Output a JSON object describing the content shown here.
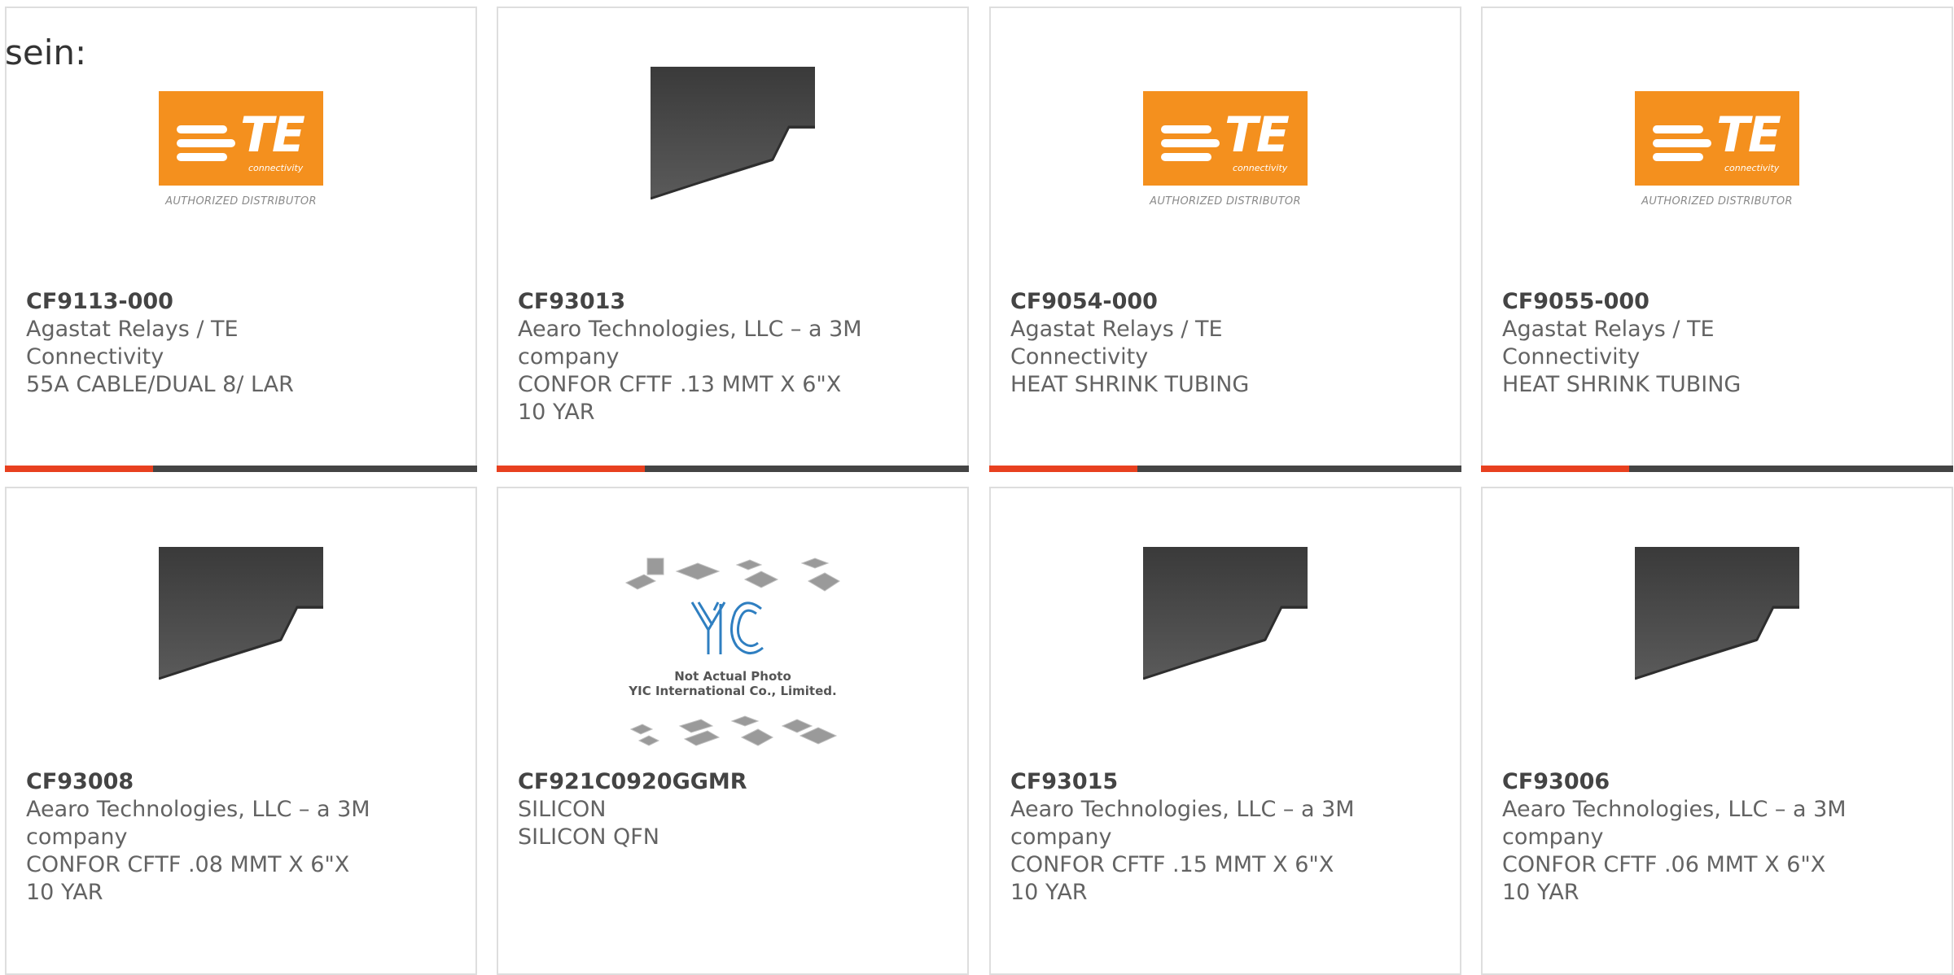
{
  "lead_text": "sein:",
  "logo": {
    "te_letters": "TE",
    "te_sub": "connectivity",
    "authorized": "AUTHORIZED DISTRIBUTOR"
  },
  "yic_image": {
    "mark": "YIC",
    "caption_line1": "Not Actual Photo",
    "caption_line2": "YIC International Co., Limited."
  },
  "colors": {
    "accent": "#e8401f",
    "bar": "#444444",
    "te_orange": "#f4901e",
    "yic_blue": "#2f7fc1"
  },
  "products": [
    {
      "part": "CF9113-000",
      "maker": "Agastat Relays / TE Connectivity",
      "desc": "55A CABLE/DUAL 8/ LAR",
      "image": "te-logo"
    },
    {
      "part": "CF93013",
      "maker": "Aearo Technologies, LLC – a 3M company",
      "desc": "CONFOR CFTF .13 MMT X 6\"X 10 YAR",
      "image": "foam-sheet"
    },
    {
      "part": "CF9054-000",
      "maker": "Agastat Relays / TE Connectivity",
      "desc": "HEAT SHRINK TUBING",
      "image": "te-logo"
    },
    {
      "part": "CF9055-000",
      "maker": "Agastat Relays / TE Connectivity",
      "desc": "HEAT SHRINK TUBING",
      "image": "te-logo"
    },
    {
      "part": "CF93008",
      "maker": "Aearo Technologies, LLC – a 3M company",
      "desc": "CONFOR CFTF .08 MMT X 6\"X 10 YAR",
      "image": "foam-sheet"
    },
    {
      "part": "CF921C0920GGMR",
      "maker": "SILICON",
      "desc": "SILICON QFN",
      "image": "yic-placeholder"
    },
    {
      "part": "CF93015",
      "maker": "Aearo Technologies, LLC – a 3M company",
      "desc": "CONFOR CFTF .15 MMT X 6\"X 10 YAR",
      "image": "foam-sheet"
    },
    {
      "part": "CF93006",
      "maker": "Aearo Technologies, LLC – a 3M company",
      "desc": "CONFOR CFTF .06 MMT X 6\"X 10 YAR",
      "image": "foam-sheet"
    }
  ]
}
